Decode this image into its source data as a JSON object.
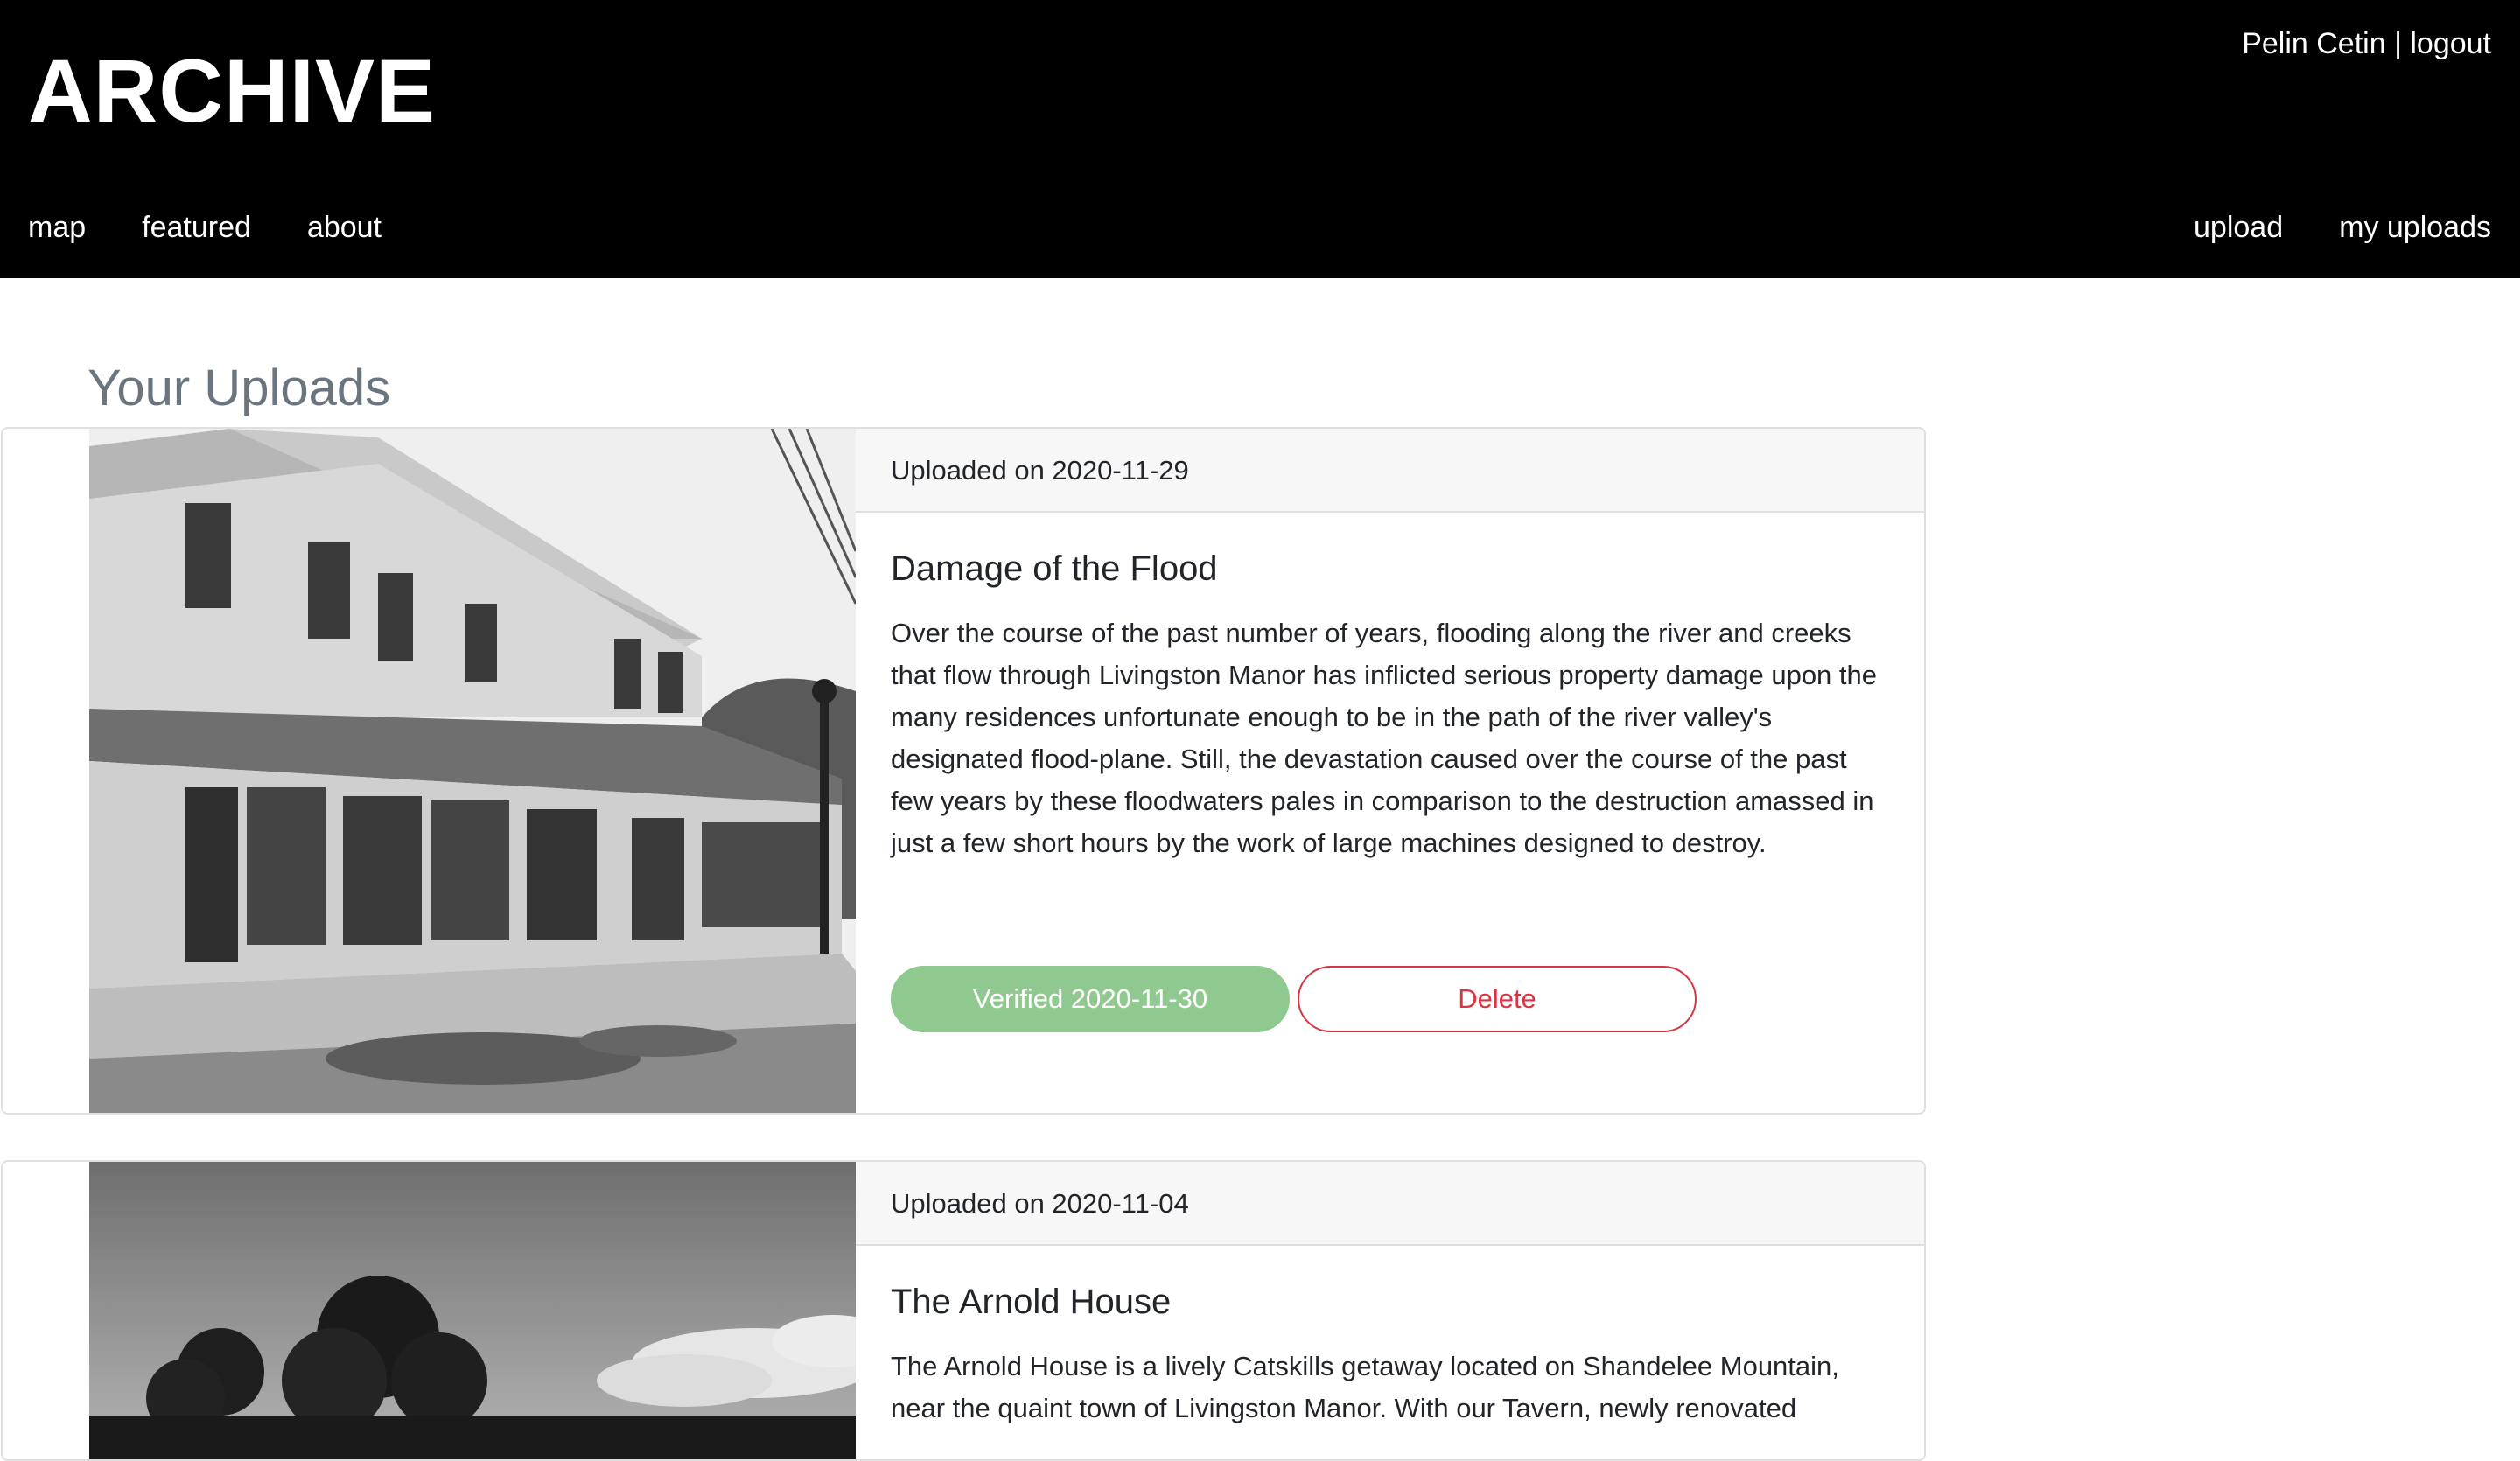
{
  "header": {
    "brand": "ARCHIVE",
    "user_name": "Pelin Cetin",
    "separator": "|",
    "logout_label": "logout",
    "nav_left": [
      "map",
      "featured",
      "about"
    ],
    "nav_right": [
      "upload",
      "my uploads"
    ]
  },
  "page": {
    "title": "Your Uploads"
  },
  "uploads": [
    {
      "uploaded": "Uploaded on 2020-11-29",
      "title": "Damage of the Flood",
      "description": "Over the course of the past number of years, flooding along the river and creeks that flow through Livingston Manor has inflicted serious property damage upon the many residences unfortunate enough to be in the path of the river valley's designated flood-plane. Still, the devastation caused over the course of the past few years by these floodwaters pales in comparison to the destruction amassed in just a few short hours by the work of large machines designed to destroy.",
      "status_label": "Verified 2020-11-30",
      "delete_label": "Delete",
      "image_icon": "storefront-photo"
    },
    {
      "uploaded": "Uploaded on 2020-11-04",
      "title": "The Arnold House",
      "description": "The Arnold House is a lively Catskills getaway located on Shandelee Mountain, near the quaint town of Livingston Manor. With our Tavern, newly renovated",
      "image_icon": "trees-photo"
    }
  ],
  "colors": {
    "header_bg": "#000000",
    "verified_green": "#8fc98f",
    "delete_red": "#d93442",
    "title_gray": "#6c757d"
  }
}
